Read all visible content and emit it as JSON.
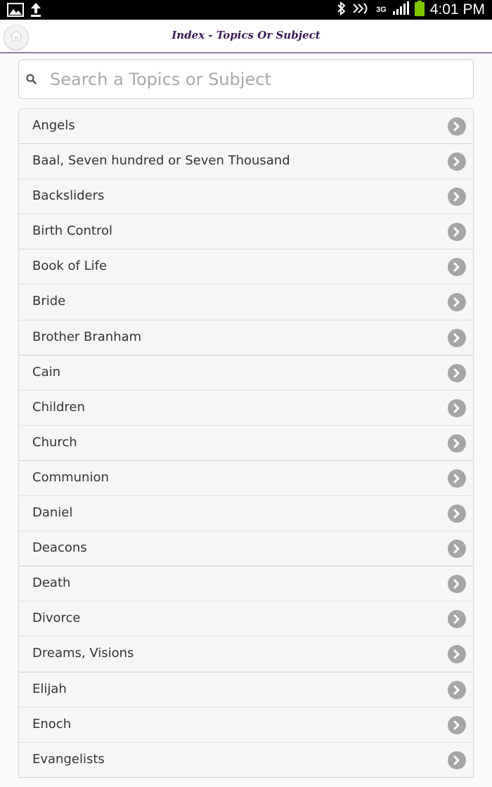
{
  "status_bar": {
    "time": "4:01 PM",
    "network": "3G",
    "icons": [
      "image-icon",
      "upload-icon",
      "bluetooth-icon",
      "nfc-icon",
      "signal-icon",
      "battery-icon"
    ],
    "battery_color": "#7ec500"
  },
  "header": {
    "title": "Index - Topics Or Subject",
    "home_icon": "home-icon",
    "accent_color": "#8f7ba6"
  },
  "search": {
    "placeholder": "Search a Topics or Subject",
    "value": ""
  },
  "topics": [
    {
      "label": "Angels"
    },
    {
      "label": "Baal, Seven hundred or Seven Thousand"
    },
    {
      "label": "Backsliders"
    },
    {
      "label": "Birth Control"
    },
    {
      "label": "Book of Life"
    },
    {
      "label": "Bride"
    },
    {
      "label": "Brother Branham"
    },
    {
      "label": "Cain"
    },
    {
      "label": "Children"
    },
    {
      "label": "Church"
    },
    {
      "label": "Communion"
    },
    {
      "label": "Daniel"
    },
    {
      "label": "Deacons"
    },
    {
      "label": "Death"
    },
    {
      "label": "Divorce"
    },
    {
      "label": "Dreams, Visions"
    },
    {
      "label": "Elijah"
    },
    {
      "label": "Enoch"
    },
    {
      "label": "Evangelists"
    }
  ]
}
